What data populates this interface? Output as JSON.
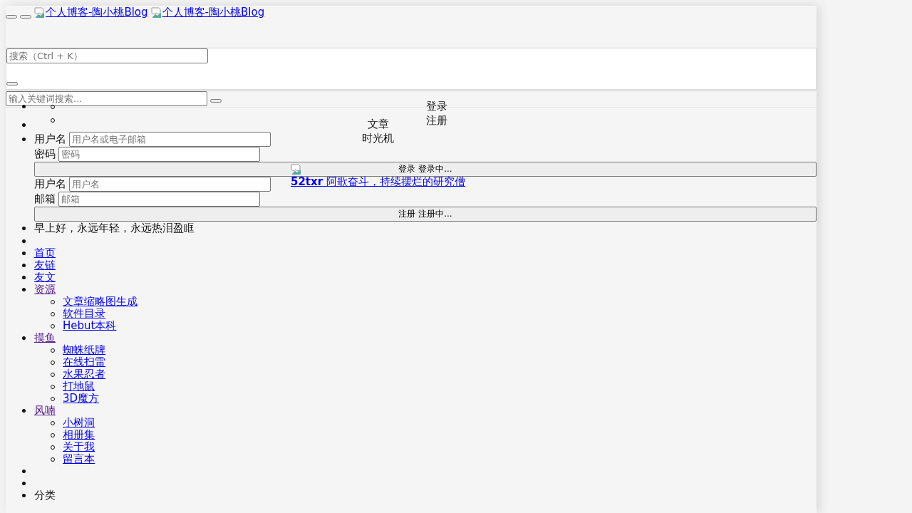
{
  "header": {
    "logo_links": [
      "个人博客-陶小桃Blog",
      "个人博客-陶小桃Blog"
    ]
  },
  "search": {
    "placeholder": "搜索（Ctrl + K）"
  },
  "keyword_search": {
    "placeholder": "输入关键词搜索..."
  },
  "account_menu": [
    "登录",
    "注册"
  ],
  "archive_menu": [
    "文章",
    "时光机"
  ],
  "login_form": {
    "fields": [
      {
        "label": "用户名",
        "placeholder": "用户名或电子邮箱"
      },
      {
        "label": "密码",
        "placeholder": "密码"
      }
    ],
    "button": "登录 登录中..."
  },
  "register_form": {
    "fields": [
      {
        "label": "用户名",
        "placeholder": "用户名"
      },
      {
        "label": "邮箱",
        "placeholder": "邮箱"
      }
    ],
    "button": "注册 注册中..."
  },
  "site_link": "**52txr** 阿歌奋斗，持续摆烂的研究僧",
  "greeting": "早上好，永远年轻，永远热泪盈眶",
  "nav": [
    {
      "label": "首页",
      "visited": false
    },
    {
      "label": "友链",
      "visited": false
    },
    {
      "label": "友文",
      "visited": false
    },
    {
      "label": "资源",
      "visited": true,
      "children": [
        {
          "label": "文章缩略图生成"
        },
        {
          "label": "软件目录"
        },
        {
          "label": "Hebut本科"
        }
      ]
    },
    {
      "label": "摸鱼",
      "visited": true,
      "children": [
        {
          "label": "蜘蛛纸牌"
        },
        {
          "label": "在线扫雷"
        },
        {
          "label": "水果忍者"
        },
        {
          "label": "打地鼠"
        },
        {
          "label": "3D魔方"
        }
      ]
    },
    {
      "label": "风喃",
      "visited": true,
      "children": [
        {
          "label": "小树洞"
        },
        {
          "label": "相册集"
        },
        {
          "label": "关于我"
        },
        {
          "label": "留言本"
        }
      ]
    }
  ],
  "categories_heading": "分类"
}
